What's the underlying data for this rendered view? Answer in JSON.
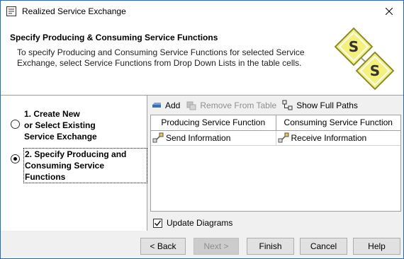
{
  "window": {
    "title": "Realized Service Exchange",
    "accent_color": "#1c6cc9"
  },
  "header": {
    "title": "Specify Producing & Consuming Service Functions",
    "description": "To specify Producing and Consuming Service Functions for selected Service Exchange, select Service Functions from Drop Down Lists in the table cells.",
    "logo_letter": "S"
  },
  "steps": [
    {
      "label": "1. Create New\nor Select Existing\nService Exchange",
      "selected": false
    },
    {
      "label": "2. Specify Producing and\nConsuming Service Functions",
      "selected": true
    }
  ],
  "toolbar": {
    "add_label": "Add",
    "remove_label": "Remove From Table",
    "show_paths_label": "Show Full Paths"
  },
  "table": {
    "columns": [
      "Producing Service Function",
      "Consuming Service Function"
    ],
    "rows": [
      [
        "Send Information",
        "Receive Information"
      ]
    ]
  },
  "update_diagrams": {
    "label": "Update Diagrams",
    "checked": true
  },
  "buttons": {
    "back": "< Back",
    "next": "Next >",
    "finish": "Finish",
    "cancel": "Cancel",
    "help": "Help"
  }
}
